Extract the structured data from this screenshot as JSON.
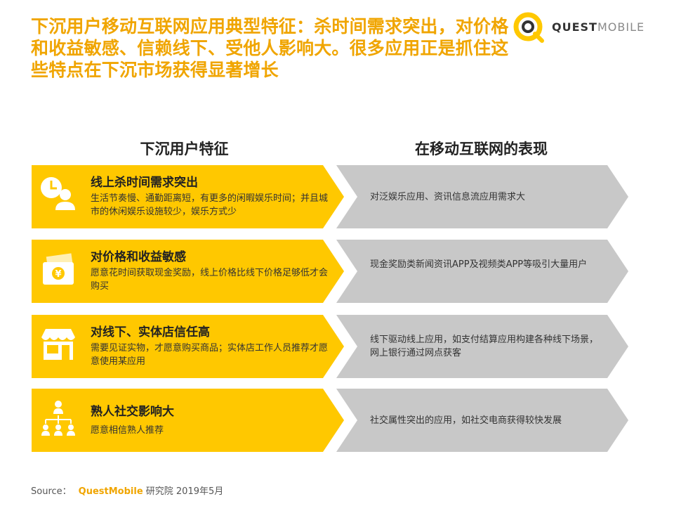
{
  "title": "下沉用户移动互联网应用典型特征：杀时间需求突出，对价格和收益敏感、信赖线下、受他人影响大。很多应用正是抓住这些特点在下沉市场获得显著增长",
  "logo": {
    "bold": "QUEST",
    "light": "MOBILE"
  },
  "columns": {
    "left": "下沉用户特征",
    "right": "在移动互联网的表现"
  },
  "rows": [
    {
      "icon": "clock-person-icon",
      "title": "线上杀时间需求突出",
      "desc": "生活节奏慢、通勤距离短，有更多的闲暇娱乐时间；并且城市的休闲娱乐设施较少，娱乐方式少",
      "effect": "对泛娱乐应用、资讯信息流应用需求大"
    },
    {
      "icon": "yuan-wallet-icon",
      "title": "对价格和收益敏感",
      "desc": "愿意花时间获取现金奖励，线上价格比线下价格足够低才会购买",
      "effect": "现金奖励类新闻资讯APP及视频类APP等吸引大量用户"
    },
    {
      "icon": "storefront-icon",
      "title": "对线下、实体店信任高",
      "desc": "需要见证实物，才愿意购买商品；实体店工作人员推荐才愿意使用某应用",
      "effect": "线下驱动线上应用，如支付结算应用构建各种线下场景，网上银行通过网点获客"
    },
    {
      "icon": "people-network-icon",
      "title": "熟人社交影响大",
      "desc": "愿意相信熟人推荐",
      "effect": "社交属性突出的应用，如社交电商获得较快发展"
    }
  ],
  "source": {
    "label": "Source：",
    "brand": "QuestMobile",
    "rest": " 研究院 2019年5月"
  },
  "colors": {
    "accent": "#ffc800",
    "title": "#f0a500",
    "gray": "#c8c8c8"
  }
}
